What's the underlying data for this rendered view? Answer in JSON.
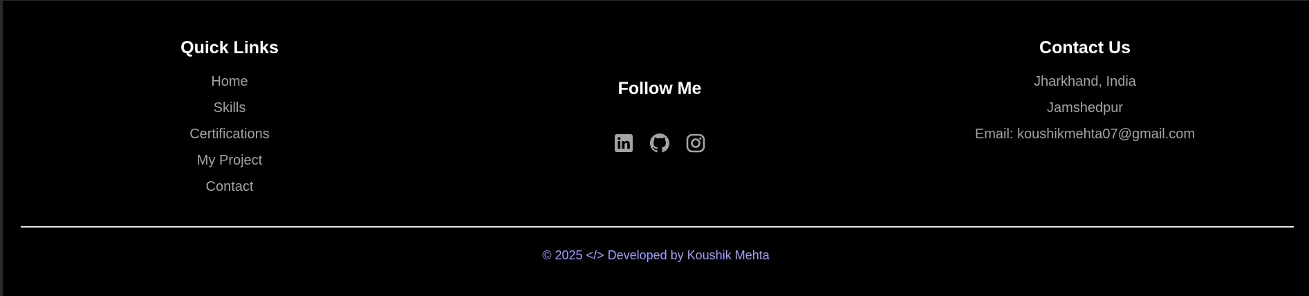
{
  "colors": {
    "background": "#000000",
    "heading": "#ffffff",
    "link": "#a3a3a3",
    "icon": "#a3a3a3",
    "copyright": "#9f9fff",
    "divider": "#e8e8e8"
  },
  "quick_links": {
    "title": "Quick Links",
    "items": [
      {
        "label": "Home"
      },
      {
        "label": "Skills"
      },
      {
        "label": "Certifications"
      },
      {
        "label": "My Project"
      },
      {
        "label": "Contact"
      }
    ]
  },
  "follow": {
    "title": "Follow Me",
    "icons": [
      "linkedin-icon",
      "github-icon",
      "instagram-icon"
    ]
  },
  "contact": {
    "title": "Contact Us",
    "location": "Jharkhand, India",
    "city": "Jamshedpur",
    "email": "Email: koushikmehta07@gmail.com"
  },
  "copyright": "© 2025 </> Developed by Koushik Mehta"
}
